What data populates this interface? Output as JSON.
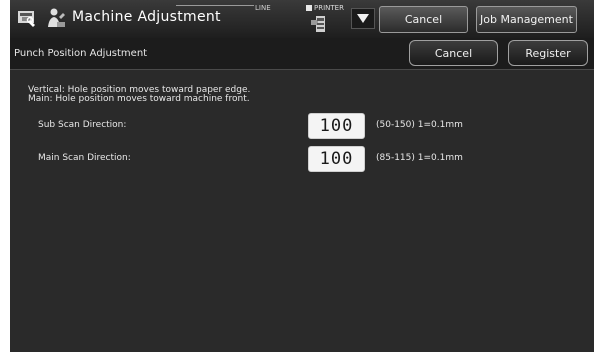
{
  "header": {
    "title": "Machine Adjustment",
    "line_label": "LINE",
    "printer_label": "PRINTER",
    "cancel_label": "Cancel",
    "job_management_label": "Job Management"
  },
  "subheader": {
    "title": "Punch Position Adjustment",
    "cancel_label": "Cancel",
    "register_label": "Register"
  },
  "notes": {
    "line1": "Vertical: Hole position moves toward paper edge.",
    "line2": "Main: Hole position moves toward machine front."
  },
  "settings": [
    {
      "label": "Sub Scan Direction:",
      "value": "100",
      "range": "(50-150) 1=0.1mm"
    },
    {
      "label": "Main Scan Direction:",
      "value": "100",
      "range": "(85-115) 1=0.1mm"
    }
  ],
  "icons": {
    "settings": "machine-settings-icon",
    "operator": "operator-icon",
    "printer_tray": "printer-tray-icon",
    "dropdown": "triangle-down-icon"
  },
  "colors": {
    "background": "#2a2a2a",
    "value_box": "#f4f4f4",
    "button_border": "#9a9a9a"
  }
}
